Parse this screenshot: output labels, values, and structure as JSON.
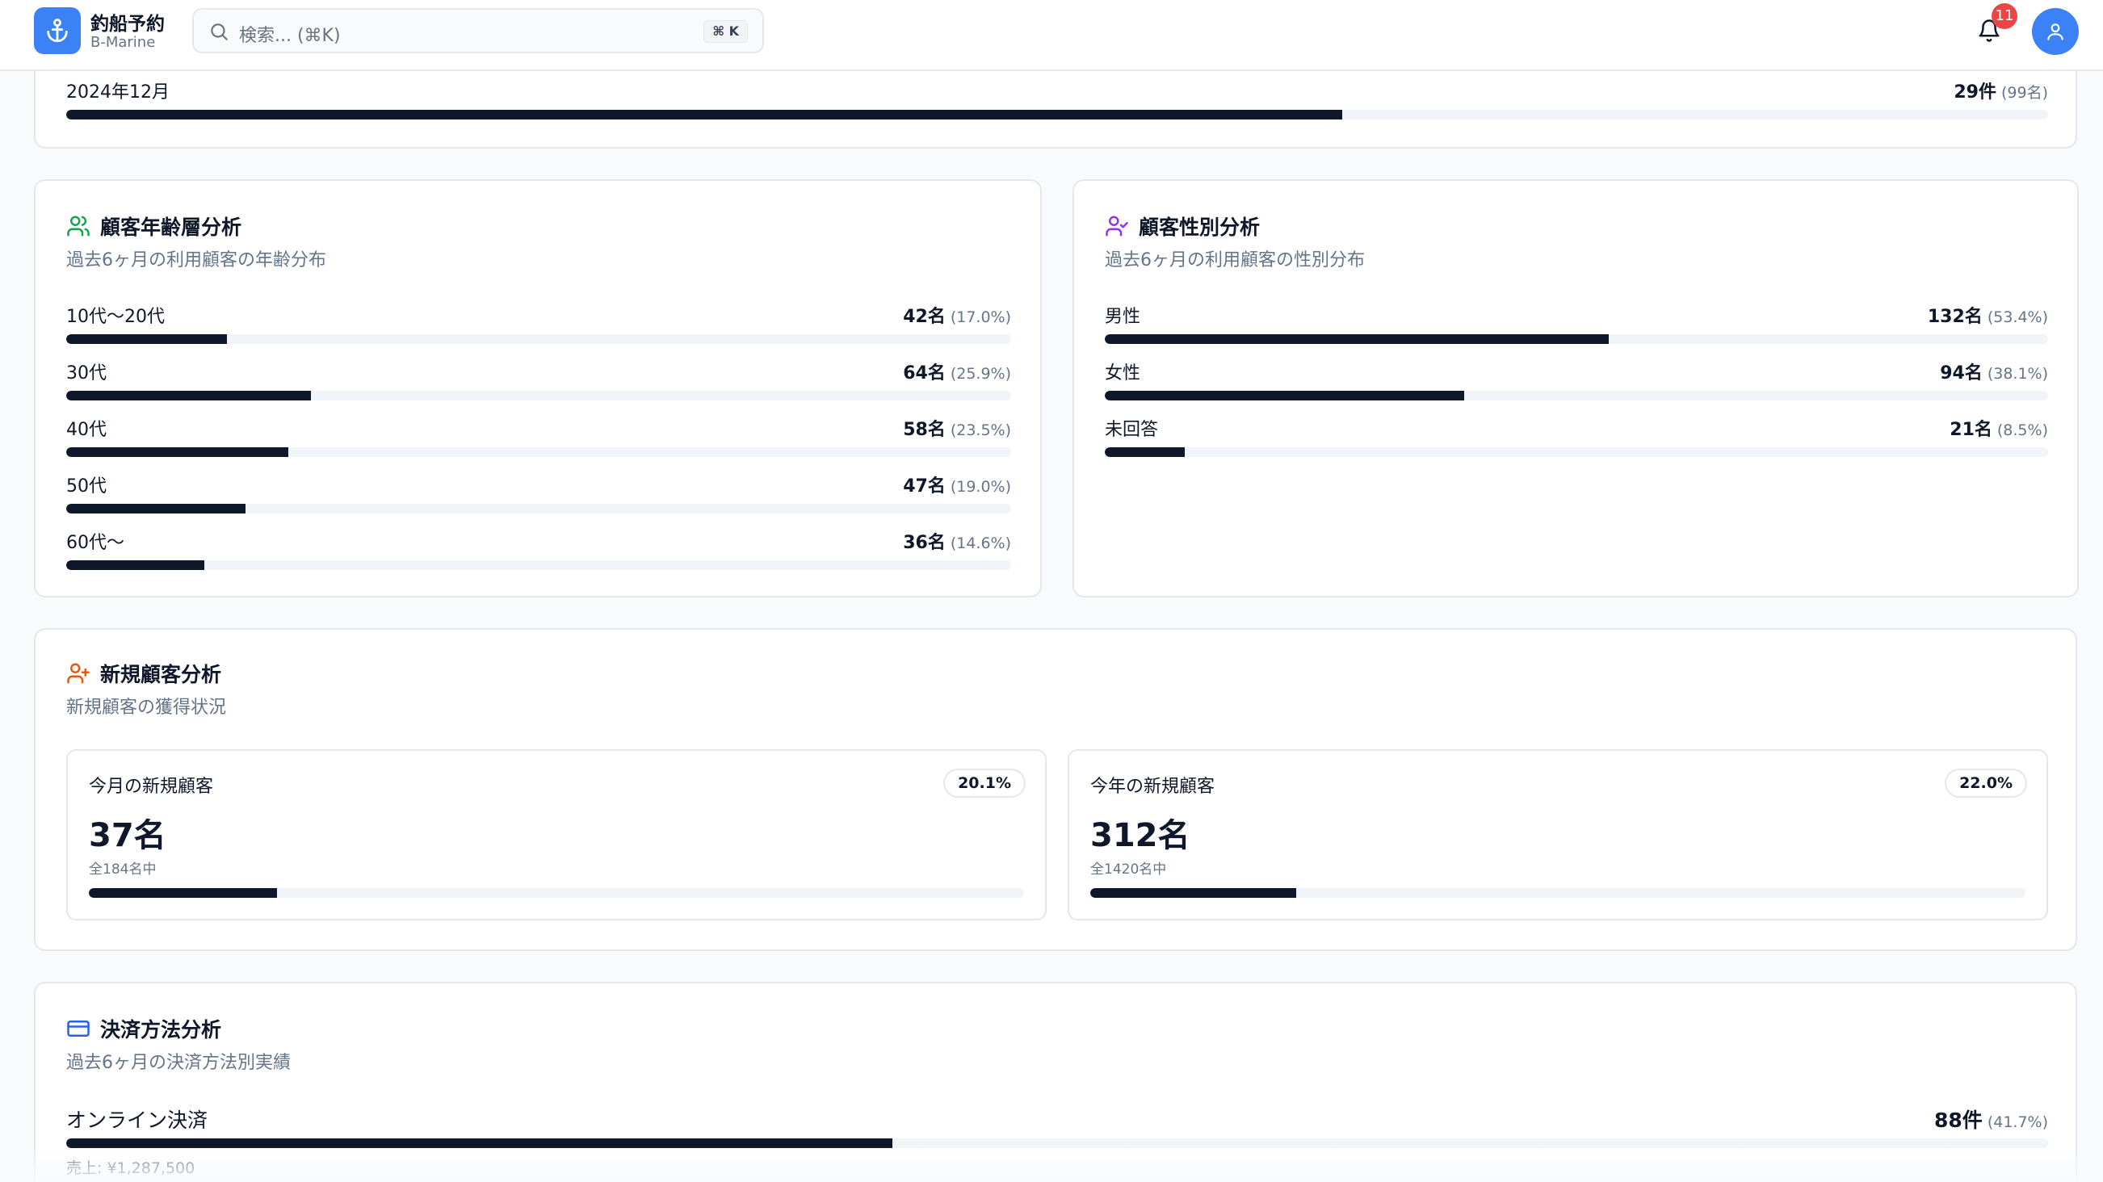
{
  "header": {
    "app_title": "釣船予約",
    "app_subtitle": "B-Marine",
    "search_placeholder": "検索... (⌘K)",
    "search_shortcut": "⌘ K",
    "notification_count": "11",
    "icons": {
      "logo": "anchor-icon",
      "search": "search-icon",
      "notifications": "bell-icon",
      "user": "user-icon"
    },
    "accent_color": "#3b82f6",
    "badge_color": "#ef4444"
  },
  "monthly_reservations": {
    "visible_row": {
      "label": "2024年12月",
      "value": "29件",
      "pct": "(99名)",
      "fill_fraction": 0.644
    }
  },
  "age_analysis": {
    "title": "顧客年齢層分析",
    "description": "過去6ヶ月の利用顧客の年齢分布",
    "icon": "users-icon",
    "icon_color": "#16a34a",
    "items": [
      {
        "label": "10代〜20代",
        "value": "42名",
        "pct": "(17.0%)",
        "fill_fraction": 0.17
      },
      {
        "label": "30代",
        "value": "64名",
        "pct": "(25.9%)",
        "fill_fraction": 0.259
      },
      {
        "label": "40代",
        "value": "58名",
        "pct": "(23.5%)",
        "fill_fraction": 0.235
      },
      {
        "label": "50代",
        "value": "47名",
        "pct": "(19.0%)",
        "fill_fraction": 0.19
      },
      {
        "label": "60代〜",
        "value": "36名",
        "pct": "(14.6%)",
        "fill_fraction": 0.146
      }
    ]
  },
  "gender_analysis": {
    "title": "顧客性別分析",
    "description": "過去6ヶ月の利用顧客の性別分布",
    "icon": "user-check-icon",
    "icon_color": "#9333ea",
    "items": [
      {
        "label": "男性",
        "value": "132名",
        "pct": "(53.4%)",
        "fill_fraction": 0.534
      },
      {
        "label": "女性",
        "value": "94名",
        "pct": "(38.1%)",
        "fill_fraction": 0.381
      },
      {
        "label": "未回答",
        "value": "21名",
        "pct": "(8.5%)",
        "fill_fraction": 0.085
      }
    ]
  },
  "new_customers": {
    "title": "新規顧客分析",
    "description": "新規顧客の獲得状況",
    "icon": "user-plus-icon",
    "icon_color": "#ea580c",
    "monthly": {
      "label": "今月の新規顧客",
      "badge": "20.1%",
      "count": "37名",
      "sub": "全184名中",
      "fill_fraction": 0.201
    },
    "yearly": {
      "label": "今年の新規顧客",
      "badge": "22.0%",
      "count": "312名",
      "sub": "全1420名中",
      "fill_fraction": 0.22
    }
  },
  "payment_analysis": {
    "title": "決済方法分析",
    "description": "過去6ヶ月の決済方法別実績",
    "icon": "credit-card-icon",
    "icon_color": "#2563eb",
    "items": [
      {
        "label": "オンライン決済",
        "value": "88件",
        "pct": "(41.7%)",
        "fill_fraction": 0.417,
        "sales": "売上: ¥1,287,500"
      }
    ]
  }
}
